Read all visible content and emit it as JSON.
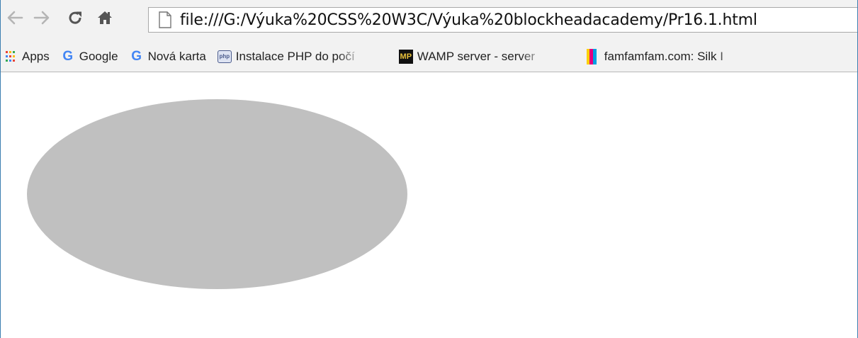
{
  "browser": {
    "url": "file:///G:/Výuka%20CSS%20W3C/Výuka%20blockheadacademy/Pr16.1.html"
  },
  "bookmarks": [
    {
      "label": "Apps",
      "icon": "apps-grid-icon"
    },
    {
      "label": "Google",
      "icon": "google-icon"
    },
    {
      "label": "Nová karta",
      "icon": "google-icon"
    },
    {
      "label": "Instalace PHP do počí",
      "icon": "php-icon"
    },
    {
      "label": "WAMP server - server",
      "icon": "mp-icon",
      "badge": "MP"
    },
    {
      "label": "famfamfam.com: Silk I",
      "icon": "color-bars-icon"
    }
  ],
  "google_letter": "G",
  "php_badge_text": "php",
  "colors": {
    "ellipse": "#c0c0c0",
    "toolbar": "#f2f2f2",
    "window_border": "#3c7fb1"
  }
}
